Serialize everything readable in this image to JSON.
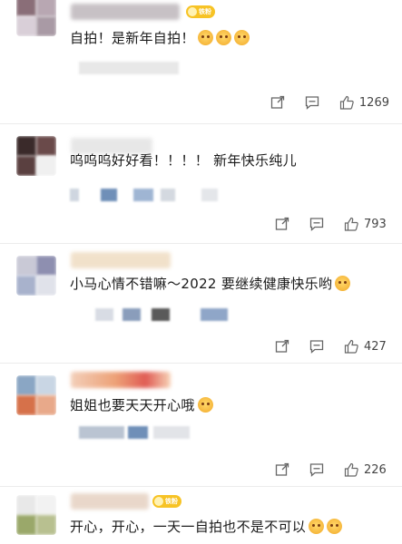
{
  "comments": [
    {
      "text": "自拍！是新年自拍！",
      "badge": "铁粉",
      "like_count": "1269",
      "emoji_icons": [
        "dog-emoji",
        "dog-emoji",
        "dog-emoji"
      ]
    },
    {
      "text": "呜呜呜好好看！！！！ 新年快乐纯儿",
      "like_count": "793"
    },
    {
      "text": "小马心情不错嘛～2022 要继续健康快乐哟",
      "like_count": "427",
      "emoji_icons": [
        "smile-emoji"
      ]
    },
    {
      "text": "姐姐也要天天开心哦",
      "like_count": "226",
      "emoji_icons": [
        "heart-eyes-emoji"
      ]
    },
    {
      "text": "开心，开心，一天一自拍也不是不可以",
      "badge": "铁粉",
      "emoji_icons": [
        "dog-emoji",
        "dog-emoji"
      ]
    }
  ],
  "icons": {
    "share": "share-icon",
    "comment": "comment-icon",
    "like": "thumbs-up-icon"
  },
  "colors": {
    "badge": "#f7c325",
    "divider": "#ececec",
    "text": "#1a1a1a"
  }
}
